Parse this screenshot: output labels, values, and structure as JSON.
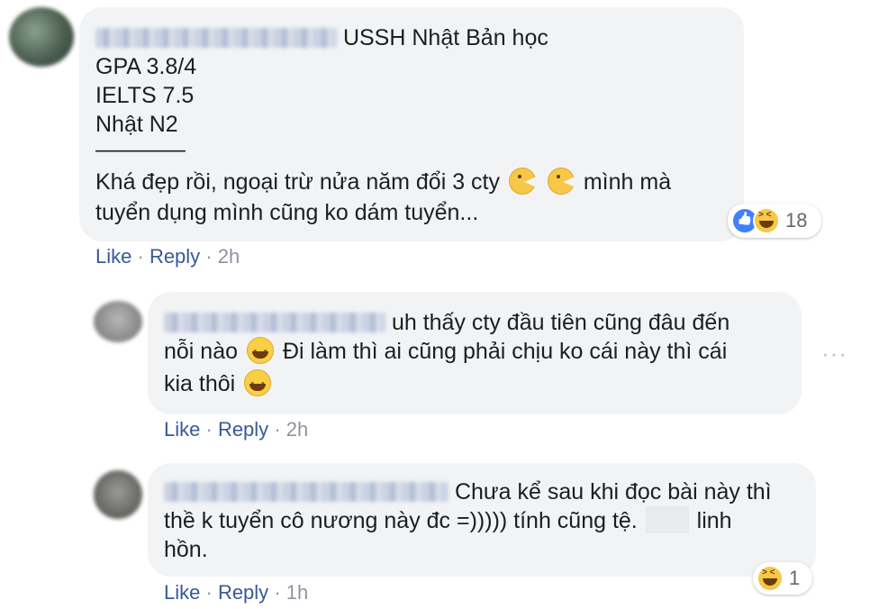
{
  "comments": [
    {
      "lines": [
        "USSH Nhật Bản học",
        "GPA 3.8/4",
        "IELTS 7.5",
        "Nhật N2",
        "————",
        "Khá đẹp rồi, ngoại trừ nửa năm đổi 3 cty",
        "mình mà",
        "tuyển dụng mình cũng ko dám tuyển..."
      ],
      "reactions_count": "18",
      "actions": {
        "like": "Like",
        "reply": "Reply",
        "time": "2h"
      }
    },
    {
      "lines": [
        "uh thấy cty đầu tiên cũng đâu đến",
        "nỗi nào",
        "Đi làm thì ai cũng phải chịu ko cái này thì cái",
        "kia thôi"
      ],
      "actions": {
        "like": "Like",
        "reply": "Reply",
        "time": "2h"
      }
    },
    {
      "lines": [
        "Chưa kể sau khi đọc bài này thì",
        "thề k tuyển cô nương này đc =))))) tính cũng tệ.",
        "linh",
        "hồn."
      ],
      "reactions_count": "1",
      "actions": {
        "like": "Like",
        "reply": "Reply",
        "time": "1h"
      }
    }
  ],
  "separator": "·",
  "more_label": "···",
  "colors": {
    "bubble": "#f2f3f5",
    "link": "#385898",
    "meta": "#8d949e"
  }
}
